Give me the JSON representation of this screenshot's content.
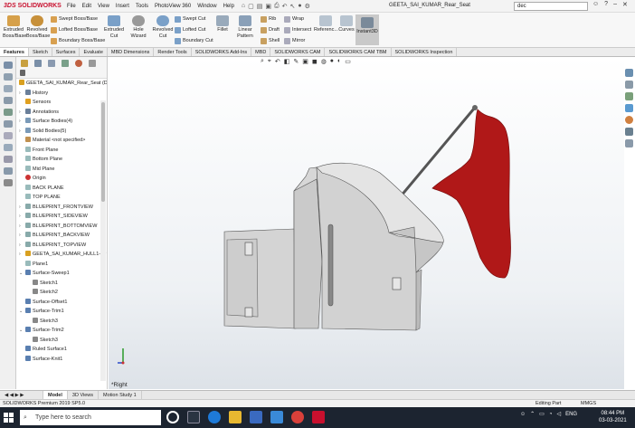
{
  "app": {
    "logo_brand": "3DS",
    "logo_text": "SOLIDWORKS",
    "menus": [
      "File",
      "Edit",
      "View",
      "Insert",
      "Tools",
      "PhotoView 360",
      "Window",
      "Help"
    ],
    "document_title": "GEETA_SAI_KUMAR_Rear_Seat",
    "search_value": "dec"
  },
  "ribbon": {
    "extruded_boss": "Extruded Boss/Base",
    "revolved_boss": "Revolved Boss/Base",
    "swept_boss": "Swept Boss/Base",
    "lofted_boss": "Lofted Boss/Base",
    "boundary_boss": "Boundary Boss/Base",
    "extruded_cut": "Extruded Cut",
    "hole_wizard": "Hole Wizard",
    "revolved_cut": "Revolved Cut",
    "swept_cut": "Swept Cut",
    "lofted_cut": "Lofted Cut",
    "boundary_cut": "Boundary Cut",
    "fillet": "Fillet",
    "linear_pattern": "Linear Pattern",
    "rib": "Rib",
    "draft": "Draft",
    "shell": "Shell",
    "wrap": "Wrap",
    "intersect": "Intersect",
    "mirror": "Mirror",
    "reference": "Referenc...",
    "curves": "Curves",
    "instant3d": "Instant3D"
  },
  "command_tabs": [
    "Features",
    "Sketch",
    "Surfaces",
    "Evaluate",
    "MBD Dimensions",
    "Render Tools",
    "SOLIDWORKS Add-Ins",
    "MBD",
    "SOLIDWORKS CAM",
    "SOLIDWORKS CAM TBM",
    "SOLIDWORKS Inspection"
  ],
  "tree": {
    "root": "GEETA_SAI_KUMAR_Rear_Seat  (D",
    "items": [
      {
        "label": "History",
        "level": 1,
        "color": "#6a7f99"
      },
      {
        "label": "Sensors",
        "level": 1,
        "color": "#e0a020"
      },
      {
        "label": "Annotations",
        "level": 1,
        "color": "#6a7f99"
      },
      {
        "label": "Surface Bodies(4)",
        "level": 1,
        "color": "#7a9ab8"
      },
      {
        "label": "Solid Bodies(5)",
        "level": 1,
        "color": "#7a9ab8"
      },
      {
        "label": "Material <not specified>",
        "level": 1,
        "color": "#c09050"
      },
      {
        "label": "Front Plane",
        "level": 1,
        "color": "#9bb"
      },
      {
        "label": "Bottom Plane",
        "level": 1,
        "color": "#9bb"
      },
      {
        "label": "Mid Plane",
        "level": 1,
        "color": "#9bb"
      },
      {
        "label": "Origin",
        "level": 1,
        "color": "#c33"
      },
      {
        "label": "BACK PLANE",
        "level": 1,
        "color": "#9bb"
      },
      {
        "label": "TOP PLANE",
        "level": 1,
        "color": "#9bb"
      },
      {
        "label": "BLUEPRINT_FRONTVIEW",
        "level": 1,
        "color": "#8aa"
      },
      {
        "label": "BLUEPRINT_SIDEVIEW",
        "level": 1,
        "color": "#8aa"
      },
      {
        "label": "BLUEPRINT_BOTTOMVIEW",
        "level": 1,
        "color": "#8aa"
      },
      {
        "label": "BLUEPRINT_BACKVIEW",
        "level": 1,
        "color": "#8aa"
      },
      {
        "label": "BLUEPRINT_TOPVIEW",
        "level": 1,
        "color": "#8aa"
      },
      {
        "label": "GEETA_SAI_KUMAR_HULL1->?",
        "level": 1,
        "color": "#d9a020"
      },
      {
        "label": "Plane1",
        "level": 1,
        "color": "#9bb"
      },
      {
        "label": "Surface-Sweep1",
        "level": 1,
        "color": "#5a7fb0"
      },
      {
        "label": "Sketch1",
        "level": 2,
        "color": "#888"
      },
      {
        "label": "Sketch2",
        "level": 2,
        "color": "#888"
      },
      {
        "label": "Surface-Offset1",
        "level": 1,
        "color": "#5a7fb0"
      },
      {
        "label": "Surface-Trim1",
        "level": 1,
        "color": "#5a7fb0"
      },
      {
        "label": "Sketch3",
        "level": 2,
        "color": "#888"
      },
      {
        "label": "Surface-Trim2",
        "level": 1,
        "color": "#5a7fb0"
      },
      {
        "label": "Sketch3",
        "level": 2,
        "color": "#888"
      },
      {
        "label": "Ruled Surface1",
        "level": 1,
        "color": "#5a7fb0"
      },
      {
        "label": "Surface-Knit1",
        "level": 1,
        "color": "#5a7fb0"
      }
    ]
  },
  "viewport": {
    "view_label": "*Right",
    "flag_color": "#b01818"
  },
  "model_tabs": [
    "Model",
    "3D Views",
    "Motion Study 1"
  ],
  "status": {
    "version": "SOLIDWORKS Premium 2019 SP5.0",
    "mode": "Editing Part",
    "units": "MMGS"
  },
  "taskbar": {
    "search_placeholder": "Type here to search",
    "language": "ENG",
    "time": "08:44 PM",
    "date": "03-03-2021"
  }
}
